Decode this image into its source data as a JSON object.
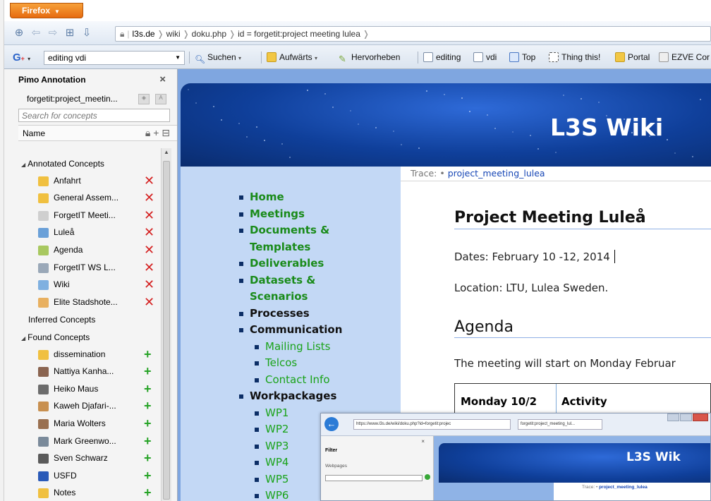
{
  "browser": {
    "menu_button": "Firefox",
    "url_segments": [
      "l3s.de",
      "wiki",
      "doku.php",
      "id = forgetit:project meeting lulea"
    ]
  },
  "bookmarks_bar": {
    "search_value": "editing vdi",
    "items": [
      "Suchen",
      "Aufwärts",
      "Hervorheben",
      "editing",
      "vdi",
      "Top",
      "Thing this!",
      "Portal",
      "EZVE Cor"
    ]
  },
  "sidebar": {
    "title": "Pimo Annotation",
    "document": "forgetit:project_meetin...",
    "search_placeholder": "Search for concepts",
    "column_header": "Name",
    "groups": {
      "annotated": "Annotated Concepts",
      "inferred": "Inferred Concepts",
      "found": "Found Concepts"
    },
    "annotated_items": [
      {
        "label": "Anfahrt",
        "icon": "folder-icon",
        "color": "#f0c040"
      },
      {
        "label": "General Assem...",
        "icon": "folder-icon",
        "color": "#f0c040"
      },
      {
        "label": "ForgetIT Meeti...",
        "icon": "document-icon",
        "color": "#cfcfcf"
      },
      {
        "label": "Luleå",
        "icon": "city-icon",
        "color": "#6aa0d8"
      },
      {
        "label": "Agenda",
        "icon": "agenda-icon",
        "color": "#a8c860"
      },
      {
        "label": "ForgetIT WS L...",
        "icon": "meeting-icon",
        "color": "#9aa8b8"
      },
      {
        "label": "Wiki",
        "icon": "wiki-icon",
        "color": "#7fb0e0"
      },
      {
        "label": "Elite Stadshote...",
        "icon": "hotel-icon",
        "color": "#e8b060"
      }
    ],
    "found_items": [
      {
        "label": "dissemination",
        "icon": "folder-icon",
        "color": "#f0c040"
      },
      {
        "label": "Nattiya Kanha...",
        "icon": "person-icon",
        "color": "#8a6450"
      },
      {
        "label": "Heiko Maus",
        "icon": "person-icon",
        "color": "#6c6c6c"
      },
      {
        "label": "Kaweh Djafari-...",
        "icon": "person-icon",
        "color": "#c89050"
      },
      {
        "label": "Maria Wolters",
        "icon": "person-icon",
        "color": "#9a7050"
      },
      {
        "label": "Mark Greenwo...",
        "icon": "person-icon",
        "color": "#7a8a9a"
      },
      {
        "label": "Sven Schwarz",
        "icon": "person-icon",
        "color": "#5a5a5a"
      },
      {
        "label": "USFD",
        "icon": "organization-icon",
        "color": "#2a5ab8"
      },
      {
        "label": "Notes",
        "icon": "folder-icon",
        "color": "#f0c040"
      }
    ]
  },
  "wiki": {
    "site_title": "L3S Wiki",
    "nav": [
      {
        "label": "Home",
        "type": "main"
      },
      {
        "label": "Meetings",
        "type": "main"
      },
      {
        "label": "Documents &",
        "type": "main"
      },
      {
        "label": "Templates",
        "type": "cont"
      },
      {
        "label": "Deliverables",
        "type": "main"
      },
      {
        "label": "Datasets &",
        "type": "main"
      },
      {
        "label": "Scenarios",
        "type": "cont"
      },
      {
        "label": "Processes",
        "type": "dark"
      },
      {
        "label": "Communication",
        "type": "dark"
      },
      {
        "label": "Mailing Lists",
        "type": "sub"
      },
      {
        "label": "Telcos",
        "type": "sub"
      },
      {
        "label": "Contact Info",
        "type": "sub"
      },
      {
        "label": "Workpackages",
        "type": "dark"
      },
      {
        "label": "WP1",
        "type": "sub"
      },
      {
        "label": "WP2",
        "type": "sub"
      },
      {
        "label": "WP3",
        "type": "sub"
      },
      {
        "label": "WP4",
        "type": "sub"
      },
      {
        "label": "WP5",
        "type": "sub"
      },
      {
        "label": "WP6",
        "type": "sub"
      }
    ],
    "trace_label": "Trace:",
    "trace_link": "project_meeting_lulea",
    "heading": "Project Meeting Luleå",
    "dates": "Dates: February 10 -12, 2014",
    "location": "Location: LTU, Lulea Sweden.",
    "agenda_heading": "Agenda",
    "intro": "The meeting will start on Monday Februar",
    "table": {
      "col1": "Monday 10/2",
      "col2": "Activity"
    }
  },
  "embedded_screenshot": {
    "url": "https://www.l3s.de/wiki/doku.php?id=forgetit:projec",
    "tab": "forgetit:project_meeting_lul...",
    "filter_label": "Filter",
    "webpages_label": "Webpages",
    "site_title": "L3S Wik",
    "trace_label": "Trace:",
    "trace_link": "project_meeting_lulea"
  }
}
